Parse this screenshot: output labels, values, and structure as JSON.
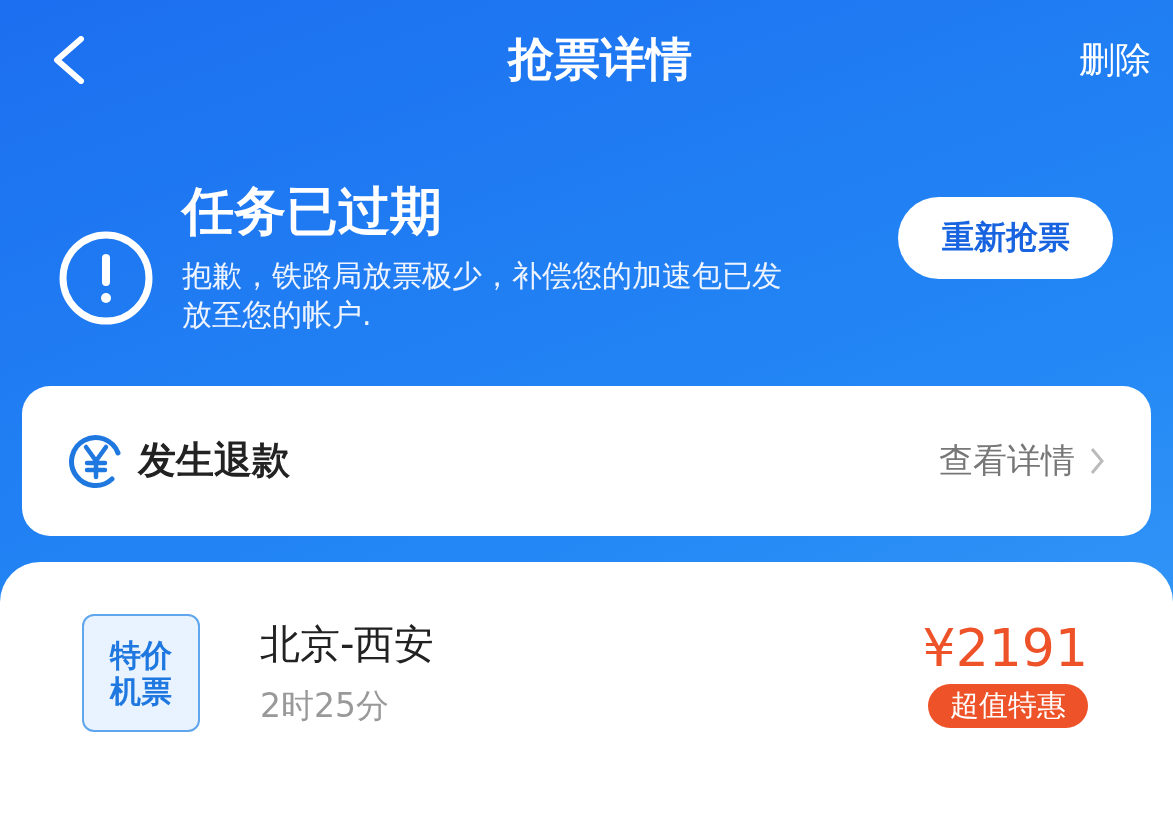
{
  "header": {
    "title": "抢票详情",
    "action": "删除"
  },
  "status": {
    "title": "任务已过期",
    "message": "抱歉，铁路局放票极少，补偿您的加速包已发放至您的帐户.",
    "button": "重新抢票"
  },
  "refund": {
    "label": "发生退款",
    "link": "查看详情"
  },
  "ticket": {
    "logo_lines": [
      "特价",
      "机票"
    ],
    "route": "北京-西安",
    "duration": "2时25分",
    "price": "¥2191",
    "tag": "超值特惠"
  }
}
